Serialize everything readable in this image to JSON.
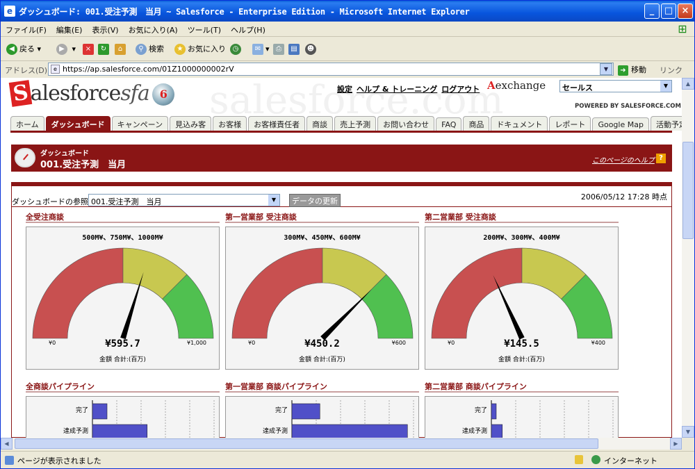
{
  "window": {
    "title": "ダッシュボード: 001.受注予測　当月 ~ Salesforce - Enterprise Edition - Microsoft Internet Explorer"
  },
  "menu": [
    "ファイル(F)",
    "編集(E)",
    "表示(V)",
    "お気に入り(A)",
    "ツール(T)",
    "ヘルプ(H)"
  ],
  "toolbar": {
    "back": "戻る",
    "search": "検索",
    "favorites": "お気に入り"
  },
  "address": {
    "label": "アドレス(D)",
    "url": "https://ap.salesforce.com/01Z1000000002rV",
    "go": "移動",
    "links": "リンク"
  },
  "sf": {
    "logo_main": "alesforce",
    "logo_sfa": "sfa",
    "logo_version": "6",
    "watermark": "salesforce.com",
    "links": [
      "設定",
      "ヘルプ & トレーニング",
      "ログアウト"
    ],
    "appexchange": "exchange",
    "app_select": "セールス",
    "powered": "POWERED BY SALESFORCE.COM",
    "tabs": [
      "ホーム",
      "ダッシュボード",
      "キャンペーン",
      "見込み客",
      "お客様",
      "お客様責任者",
      "商談",
      "売上予測",
      "お問い合わせ",
      "FAQ",
      "商品",
      "ドキュメント",
      "レポート",
      "Google Map",
      "活動予定/実"
    ],
    "active_tab": 1
  },
  "page": {
    "subtitle": "ダッシュボード",
    "title": "001.受注予測　当月",
    "help": "このページのヘルプ",
    "view_label": "ダッシュボードの参照",
    "view_select": "001.受注予測　当月",
    "refresh": "データの更新",
    "timestamp": "2006/05/12 17:28 時点"
  },
  "gauges": [
    {
      "title": "全受注商談",
      "range": "500M¥、750M¥、1000M¥",
      "min_label": "¥0",
      "max_label": "¥1,000",
      "value_label": "¥595.7",
      "unit": "金額 合計:(百万)",
      "value": 595.7,
      "max": 1000,
      "b1": 500,
      "b2": 750
    },
    {
      "title": "第一営業部 受注商談",
      "range": "300M¥、450M¥、600M¥",
      "min_label": "¥0",
      "max_label": "¥600",
      "value_label": "¥450.2",
      "unit": "金額 合計:(百万)",
      "value": 450.2,
      "max": 600,
      "b1": 300,
      "b2": 450
    },
    {
      "title": "第二営業部 受注商談",
      "range": "200M¥、300M¥、400M¥",
      "min_label": "¥0",
      "max_label": "¥400",
      "value_label": "¥145.5",
      "unit": "金額 合計:(百万)",
      "value": 145.5,
      "max": 400,
      "b1": 200,
      "b2": 300
    }
  ],
  "pipelines": [
    {
      "title": "全商談パイプライン",
      "labels": [
        "完了",
        "達成予測"
      ],
      "values": [
        0.12,
        0.45
      ]
    },
    {
      "title": "第一営業部 商談パイプライン",
      "labels": [
        "完了",
        "達成予測"
      ],
      "values": [
        0.23,
        0.95
      ]
    },
    {
      "title": "第二営業部 商談パイプライン",
      "labels": [
        "完了",
        "達成予測"
      ],
      "values": [
        0.04,
        0.09
      ]
    }
  ],
  "status": {
    "message": "ページが表示されました",
    "zone": "インターネット"
  },
  "colors": {
    "red": "#c85050",
    "yellow": "#c8c850",
    "green": "#50c050",
    "brand": "#8a1515",
    "bar": "#5050c8"
  }
}
